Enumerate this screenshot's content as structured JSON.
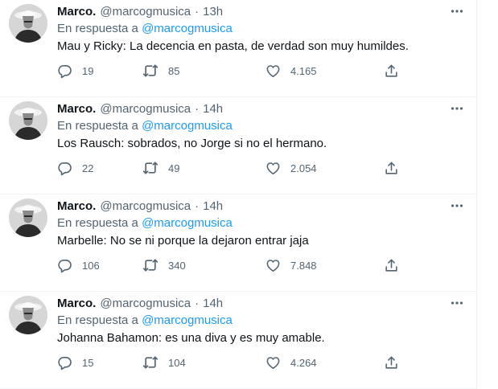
{
  "tweets": [
    {
      "name": "Marco.",
      "handle": "@marcogmusica",
      "time": "13h",
      "reply_prefix": "En respuesta a",
      "reply_mention": "@marcogmusica",
      "text": "Mau y Ricky: La decencia en pasta, de verdad son muy humildes.",
      "replies": "19",
      "retweets": "85",
      "likes": "4.165"
    },
    {
      "name": "Marco.",
      "handle": "@marcogmusica",
      "time": "14h",
      "reply_prefix": "En respuesta a",
      "reply_mention": "@marcogmusica",
      "text": "Los Rausch: sobrados, no Jorge si no el hermano.",
      "replies": "22",
      "retweets": "49",
      "likes": "2.054"
    },
    {
      "name": "Marco.",
      "handle": "@marcogmusica",
      "time": "14h",
      "reply_prefix": "En respuesta a",
      "reply_mention": "@marcogmusica",
      "text": "Marbelle: No se ni porque la dejaron entrar jaja",
      "replies": "106",
      "retweets": "340",
      "likes": "7.848"
    },
    {
      "name": "Marco.",
      "handle": "@marcogmusica",
      "time": "14h",
      "reply_prefix": "En respuesta a",
      "reply_mention": "@marcogmusica",
      "text": "Johanna Bahamon: es una diva y es muy amable.",
      "replies": "15",
      "retweets": "104",
      "likes": "4.264"
    }
  ],
  "icons": {
    "avatar": "profile-photo",
    "more": "more-horizontal-icon",
    "reply": "reply-icon",
    "retweet": "retweet-icon",
    "like": "heart-icon",
    "share": "share-icon"
  },
  "colors": {
    "text": "#0f1419",
    "secondary": "#536471",
    "link": "#1d9bf0",
    "border": "#eff3f4"
  }
}
